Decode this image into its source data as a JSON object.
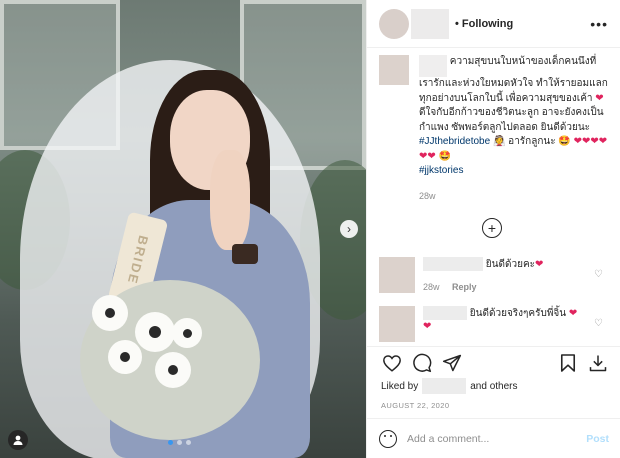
{
  "header": {
    "follow_label": "• Following",
    "more_label": "•••"
  },
  "caption": {
    "text_1": "ความสุขบนใบหน้าของเด็กคนนึงที่เรารักและห่วงใยหมดหัวใจ ทำให้รายอมแลกทุกอย่างบนโลกใบนี้ เพื่อความสุขของเค้า",
    "text_2": " ดีใจกับอีกก้าวของชีวิตนะลูก อาจะยังคงเป็นกำแพง ซัพพอร์ตลูกไปตลอด ยินดีด้วยนะ ",
    "hashtag_1": "#JJthebridetobe",
    "text_3": " 👰 อารักลูกนะ 🤩",
    "hearts": "❤❤❤❤❤❤",
    "text_4": "🤩",
    "hashtag_2": "#jjkstories",
    "time": "28w"
  },
  "comments": [
    {
      "text": "ยินดีด้วยคะ",
      "heart": "❤",
      "time": "28w",
      "reply_label": "Reply"
    },
    {
      "text": "ยินดีด้วยจริงๆครับพี่จิ้น",
      "heart": "❤",
      "heart_2": "❤"
    }
  ],
  "likes": {
    "prefix": "Liked by",
    "suffix": "and others"
  },
  "date": "AUGUST 22, 2020",
  "add_comment": {
    "placeholder": "Add a comment...",
    "post_label": "Post"
  },
  "photo": {
    "sash_text": "BRIDE",
    "next_label": "›"
  }
}
